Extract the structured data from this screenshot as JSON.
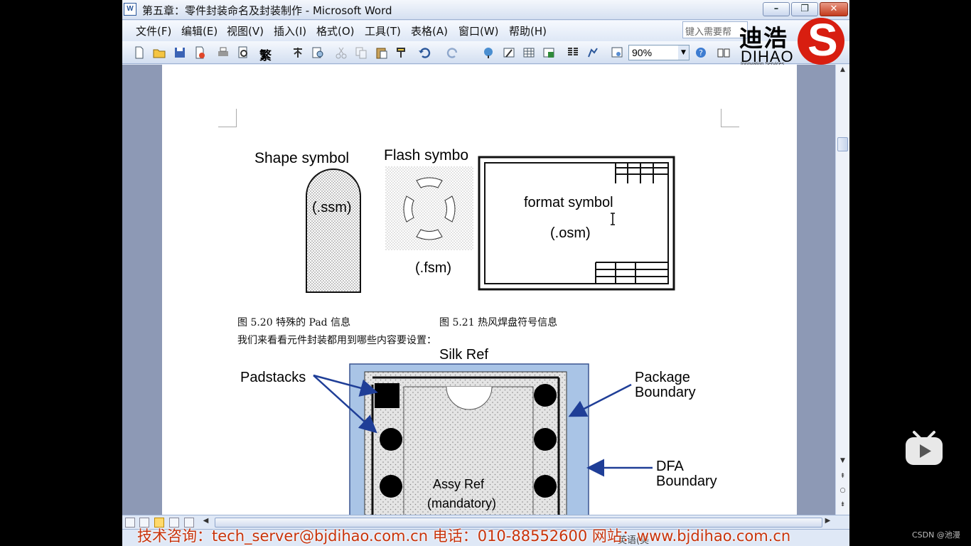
{
  "window": {
    "title": "第五章：零件封装命名及封装制作 - Microsoft Word",
    "doc_icon": "W",
    "minimize": "–",
    "maximize": "❐",
    "close": "✕"
  },
  "menu": {
    "items": [
      "文件(F)",
      "编辑(E)",
      "视图(V)",
      "插入(I)",
      "格式(O)",
      "工具(T)",
      "表格(A)",
      "窗口(W)",
      "帮助(H)"
    ],
    "help_placeholder": "键入需要帮"
  },
  "toolbar": {
    "zoom": "90%",
    "buttons": [
      "new-icon",
      "open-icon",
      "save-icon",
      "permission-icon",
      "print-icon",
      "print-preview-icon",
      "trad-chinese-icon",
      "simp-chinese-icon",
      "research-icon",
      "cut-icon",
      "copy-icon",
      "paste-icon",
      "format-painter-icon",
      "undo-icon",
      "redo-icon",
      "hyperlink-icon",
      "tables-borders-icon",
      "insert-table-icon",
      "insert-excel-icon",
      "columns-icon",
      "drawing-icon",
      "doc-map-icon",
      "help-icon",
      "read-icon"
    ],
    "trad_label": "繁"
  },
  "logo": {
    "chinese": "迪浩",
    "english": "DIHAO",
    "sub": "Innovation Services"
  },
  "document": {
    "figure_labels": {
      "shape_title": "Shape symbol",
      "shape_ext": "(.ssm)",
      "flash_title": "Flash symbo",
      "flash_ext": "(.fsm)",
      "format_title": "format symbol",
      "format_ext": "(.osm)"
    },
    "caption_520": "图 5.20  特殊的 Pad 信息",
    "caption_521": "图 5.21  热风焊盘符号信息",
    "body_text": "我们来看看元件封装都用到哪些内容要设置：",
    "package_labels": {
      "silk_ref": "Silk Ref",
      "padstacks": "Padstacks",
      "package_boundary_1": "Package",
      "package_boundary_2": "Boundary",
      "dfa_boundary_1": "DFA",
      "dfa_boundary_2": "Boundary",
      "assy_ref": "Assy Ref",
      "mandatory": "(mandatory)"
    }
  },
  "status": {
    "language": "英语(美"
  },
  "overlay": {
    "contact": "技术咨询：tech_server@bjdihao.com.cn    电话：010-88552600    网站：www.bjdihao.com.cn",
    "csdn": "CSDN @池漫"
  },
  "colors": {
    "title_bar": "#d5e0f1",
    "close_button": "#c33a1c",
    "contact_text": "#c8330b",
    "package_fill": "#a9c4e6",
    "arrow": "#1f3e97"
  }
}
